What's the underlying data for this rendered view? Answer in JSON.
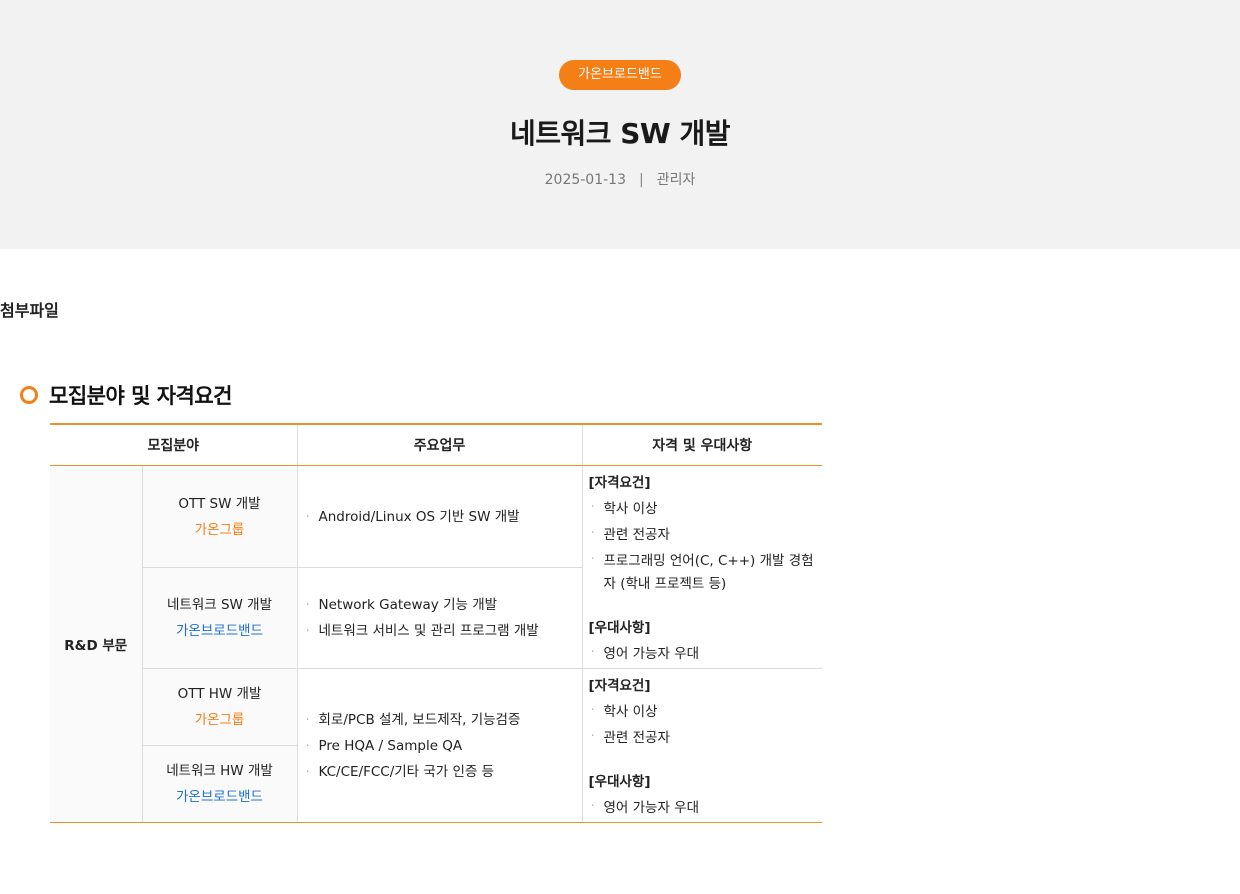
{
  "post": {
    "category": "가온브로드밴드",
    "title": "네트워크 SW 개발",
    "date": "2025-01-13",
    "separator": "|",
    "author": "관리자"
  },
  "attachments_label": "첨부파일",
  "section_title": "모집분야 및 자격요건",
  "table": {
    "headers": [
      "모집분야",
      "주요업무",
      "자격 및 우대사항"
    ],
    "department": "R&D 부문",
    "positions": [
      {
        "name": "OTT SW 개발",
        "org": "가온그룹"
      },
      {
        "name": "네트워크 SW 개발",
        "org": "가온브로드밴드"
      },
      {
        "name": "OTT HW 개발",
        "org": "가온그룹"
      },
      {
        "name": "네트워크 HW 개발",
        "org": "가온브로드밴드"
      }
    ],
    "duties": [
      [
        "Android/Linux OS 기반 SW 개발"
      ],
      [
        "Network Gateway 기능 개발",
        "네트워크 서비스 및 관리 프로그램 개발"
      ],
      [
        "회로/PCB 설계, 보드제작, 기능검증",
        "Pre HQA / Sample QA",
        "KC/CE/FCC/기타 국가 인증 등"
      ]
    ],
    "qualifications": [
      {
        "req_title": "[자격요건]",
        "req": [
          "학사 이상",
          "관련 전공자",
          "프로그래밍 언어(C, C++) 개발 경험자 (학내 프로젝트 등)"
        ],
        "pref_title": "[우대사항]",
        "pref": [
          "영어 가능자 우대"
        ]
      },
      {
        "req_title": "[자격요건]",
        "req": [
          "학사 이상",
          "관련 전공자"
        ],
        "pref_title": "[우대사항]",
        "pref": [
          "영어 가능자 우대"
        ]
      }
    ]
  },
  "colors": {
    "accent": "#f57f17",
    "blue_org": "#1d6fd1",
    "hero_bg": "#f2f2f2"
  }
}
